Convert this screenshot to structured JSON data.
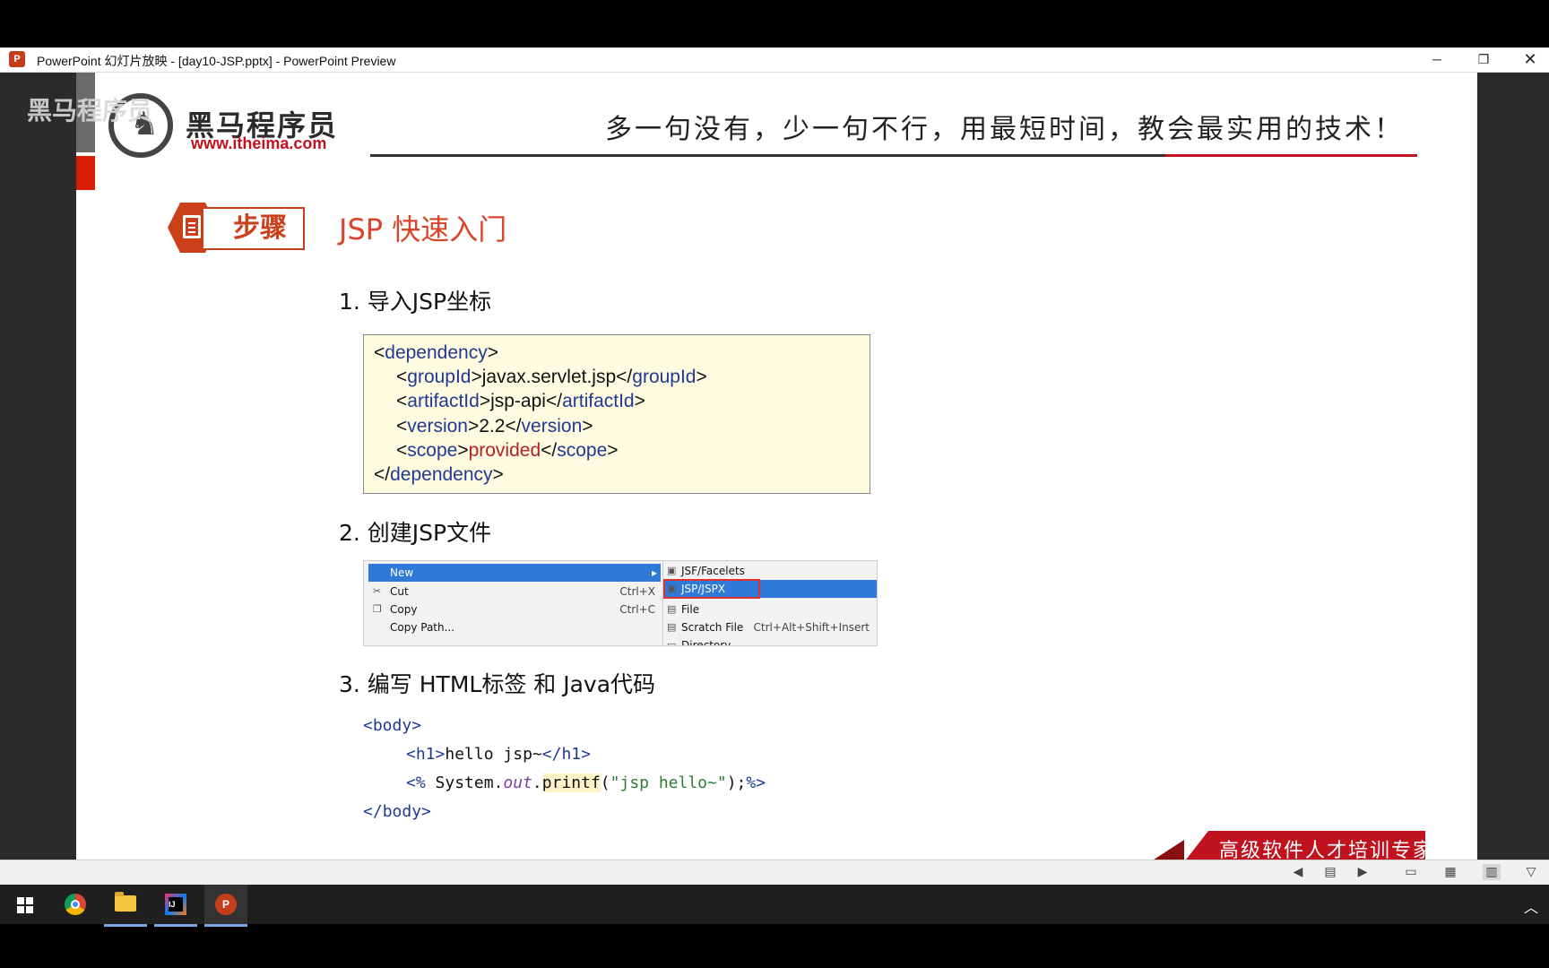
{
  "window": {
    "title": "PowerPoint 幻灯片放映 - [day10-JSP.pptx] - PowerPoint Preview",
    "app_icon_label": "P",
    "minimize_glyph": "─",
    "restore_glyph": "❐",
    "close_glyph": "✕"
  },
  "slide": {
    "watermark": "黑马程序员",
    "logo": {
      "name": "黑马程序员",
      "url": "www.itheima.com"
    },
    "slogan": "多一句没有，少一句不行，用最短时间，教会最实用的技术！",
    "step_label": "步骤",
    "title": "JSP 快速入门",
    "sections": [
      {
        "heading": "1. 导入JSP坐标"
      },
      {
        "heading": "2. 创建JSP文件"
      },
      {
        "heading": "3. 编写 HTML标签 和 Java代码"
      }
    ],
    "xml": {
      "dep_open": "dependency",
      "group_tag": "groupId",
      "group_val": "javax.servlet.jsp",
      "artifact_tag": "artifactId",
      "artifact_val": "jsp-api",
      "version_tag": "version",
      "version_val": "2.2",
      "scope_tag": "scope",
      "scope_val": "provided"
    },
    "context_menu": {
      "left": [
        {
          "label": "New",
          "shortcut": "",
          "icon": "",
          "selected": true
        },
        {
          "label": "Cut",
          "shortcut": "Ctrl+X",
          "icon": "scissors-icon"
        },
        {
          "label": "Copy",
          "shortcut": "Ctrl+C",
          "icon": "copy-icon"
        },
        {
          "label": "Copy Path...",
          "shortcut": ""
        }
      ],
      "right": [
        {
          "label": "JSF/Facelets",
          "shortcut": "",
          "icon": "jsf-file-icon"
        },
        {
          "label": "JSP/JSPX",
          "shortcut": "",
          "icon": "jsp-file-icon",
          "selected": true
        },
        {
          "label": "File",
          "shortcut": "",
          "icon": "file-icon"
        },
        {
          "label": "Scratch File",
          "shortcut": "Ctrl+Alt+Shift+Insert",
          "icon": "scratch-file-icon"
        },
        {
          "label": "Directory",
          "shortcut": "",
          "icon": "folder-icon"
        }
      ]
    },
    "code": {
      "body_open": "body",
      "h1_tag": "h1",
      "h1_text": "hello jsp~",
      "scriptlet_open": "<%",
      "system": "System",
      "out": "out",
      "printf": "printf",
      "string": "\"jsp hello~\"",
      "scriptlet_close": "%>",
      "body_close": "body"
    },
    "banner": "高级软件人才培训专家"
  },
  "status_icons": [
    "prev-slide-icon",
    "notes-icon",
    "next-slide-icon",
    "normal-view-icon",
    "slide-sorter-icon",
    "reading-view-icon",
    "slideshow-icon"
  ],
  "taskbar": {
    "items": [
      "windows-start",
      "chrome",
      "file-explorer",
      "intellij-idea",
      "powerpoint"
    ]
  },
  "colors": {
    "accent_red": "#c1121f",
    "step_orange": "#c9401a",
    "menu_select": "#2f7ad8"
  }
}
